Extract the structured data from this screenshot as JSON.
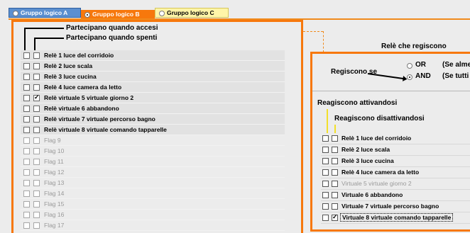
{
  "tabs": [
    {
      "label": "Gruppo logico  A",
      "selected": false
    },
    {
      "label": "Gruppo logico  B",
      "selected": true
    },
    {
      "label": "Gruppo logico  C",
      "selected": false
    }
  ],
  "left": {
    "header_accesi": "Partecipano quando  accesi",
    "header_spenti": "Partecipano quando  spenti",
    "rows": [
      {
        "label": "Relè 1 luce del corridoio",
        "accesi": false,
        "spenti": false,
        "enabled": true
      },
      {
        "label": "Relè 2 luce scala",
        "accesi": false,
        "spenti": false,
        "enabled": true
      },
      {
        "label": "Relè 3 luce cucina",
        "accesi": false,
        "spenti": false,
        "enabled": true
      },
      {
        "label": "Relè 4 luce camera da letto",
        "accesi": false,
        "spenti": false,
        "enabled": true
      },
      {
        "label": "Relè virtuale 5 virtuale giorno 2",
        "accesi": false,
        "spenti": true,
        "enabled": true
      },
      {
        "label": "Relè virtuale 6 abbandono",
        "accesi": false,
        "spenti": false,
        "enabled": true
      },
      {
        "label": "Relè virtuale 7 virtuale percorso bagno",
        "accesi": false,
        "spenti": false,
        "enabled": true
      },
      {
        "label": "Relè virtuale 8 virtuale comando tapparelle",
        "accesi": false,
        "spenti": false,
        "enabled": true
      },
      {
        "label": "Flag 9",
        "accesi": false,
        "spenti": false,
        "enabled": false
      },
      {
        "label": "Flag 10",
        "accesi": false,
        "spenti": false,
        "enabled": false
      },
      {
        "label": "Flag 11",
        "accesi": false,
        "spenti": false,
        "enabled": false
      },
      {
        "label": "Flag 12",
        "accesi": false,
        "spenti": false,
        "enabled": false
      },
      {
        "label": "Flag 13",
        "accesi": false,
        "spenti": false,
        "enabled": false
      },
      {
        "label": "Flag 14",
        "accesi": false,
        "spenti": false,
        "enabled": false
      },
      {
        "label": "Flag 15",
        "accesi": false,
        "spenti": false,
        "enabled": false
      },
      {
        "label": "Flag 16",
        "accesi": false,
        "spenti": false,
        "enabled": false
      },
      {
        "label": "Flag 17",
        "accesi": false,
        "spenti": false,
        "enabled": false
      }
    ]
  },
  "right": {
    "title": "Relè che regiscono",
    "reagiscono_se": "Regiscono se",
    "option_or": "OR",
    "option_and": "AND",
    "note_or": "(Se alme",
    "note_and": "(Se tutti",
    "selected_option": "AND",
    "header_attiv": "Reagiscono attivandosi",
    "header_disattiv": "Reagiscono disattivandosi",
    "rows": [
      {
        "label": "Relè 1 luce del corridoio",
        "attiv": false,
        "disattiv": false,
        "enabled": true
      },
      {
        "label": "Relè 2 luce scala",
        "attiv": false,
        "disattiv": false,
        "enabled": true
      },
      {
        "label": "Relè 3 luce cucina",
        "attiv": false,
        "disattiv": false,
        "enabled": true
      },
      {
        "label": "Relè 4 luce camera da letto",
        "attiv": false,
        "disattiv": false,
        "enabled": true
      },
      {
        "label": "Virtuale 5 virtuale giorno 2",
        "attiv": false,
        "disattiv": false,
        "enabled": false
      },
      {
        "label": "Virtuale 6 abbandono",
        "attiv": false,
        "disattiv": false,
        "enabled": true
      },
      {
        "label": "Virtuale 7 virtuale percorso bagno",
        "attiv": false,
        "disattiv": false,
        "enabled": true
      },
      {
        "label": "Virtuale 8 virtuale comando tapparelle",
        "attiv": false,
        "disattiv": true,
        "enabled": true,
        "focused": true
      }
    ]
  },
  "colors": {
    "accent": "#f7780c",
    "tab_a": "#5b8fcf",
    "tab_c": "#fff5a8"
  }
}
